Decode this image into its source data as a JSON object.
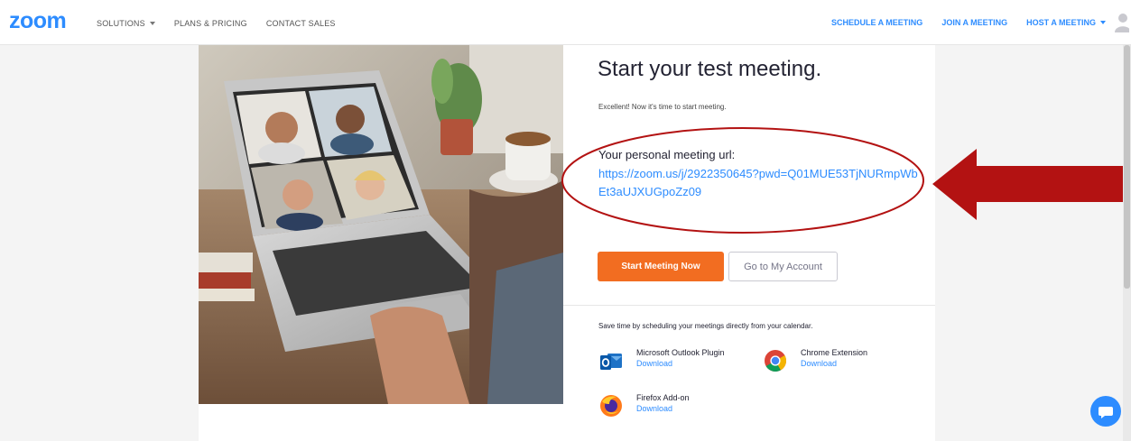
{
  "brand": {
    "logo_text": "zoom",
    "color": "#2d8cff"
  },
  "nav": {
    "left": [
      {
        "label": "SOLUTIONS",
        "has_dropdown": true
      },
      {
        "label": "PLANS & PRICING",
        "has_dropdown": false
      },
      {
        "label": "CONTACT SALES",
        "has_dropdown": false
      }
    ],
    "right": [
      {
        "label": "SCHEDULE A MEETING",
        "has_dropdown": false
      },
      {
        "label": "JOIN A MEETING",
        "has_dropdown": false
      },
      {
        "label": "HOST A MEETING",
        "has_dropdown": true
      }
    ],
    "avatar_icon": "user-avatar-icon"
  },
  "main": {
    "title": "Start your test meeting.",
    "subtitle": "Excellent! Now it's time to start meeting.",
    "url_label": "Your personal meeting url:",
    "url_value": "https://zoom.us/j/2922350645?pwd=Q01MUE53TjNURmpWbEt3aUJXUGpoZz09",
    "start_button": "Start Meeting Now",
    "account_button": "Go to My Account",
    "calendar_text": "Save time by scheduling your meetings directly from your calendar."
  },
  "plugins": [
    {
      "name": "Microsoft Outlook Plugin",
      "link": "Download",
      "icon": "outlook-icon"
    },
    {
      "name": "Chrome Extension",
      "link": "Download",
      "icon": "chrome-icon"
    },
    {
      "name": "Firefox Add-on",
      "link": "Download",
      "icon": "firefox-icon"
    }
  ],
  "colors": {
    "accent_orange": "#f26d21",
    "link_blue": "#2d8cff",
    "annotation_red": "#b31212"
  }
}
